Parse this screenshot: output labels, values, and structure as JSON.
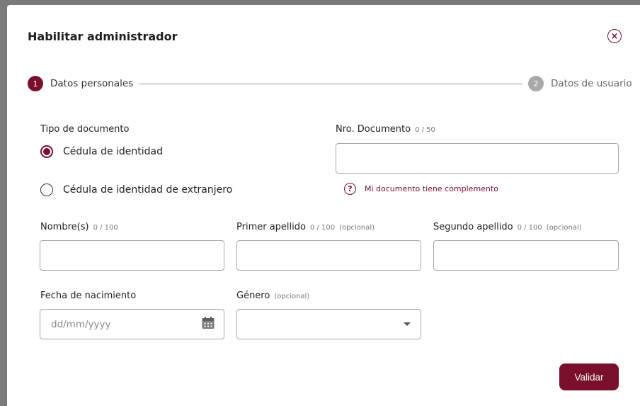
{
  "dialog": {
    "title": "Habilitar administrador",
    "close_icon": "close-icon",
    "validate_label": "Validar"
  },
  "stepper": {
    "steps": [
      {
        "number": "1",
        "label": "Datos personales",
        "state": "active"
      },
      {
        "number": "2",
        "label": "Datos de usuario",
        "state": "inactive"
      }
    ]
  },
  "form": {
    "tipo_documento": {
      "label": "Tipo de documento",
      "options": [
        {
          "label": "Cédula de identidad",
          "selected": true
        },
        {
          "label": "Cédula de identidad de extranjero",
          "selected": false
        }
      ]
    },
    "nro_documento": {
      "label": "Nro. Documento",
      "counter": "0 / 50",
      "value": ""
    },
    "complemento_link": "Mi documento tiene complemento",
    "nombres": {
      "label": "Nombre(s)",
      "counter": "0 / 100",
      "value": ""
    },
    "primer_apellido": {
      "label": "Primer apellido",
      "counter": "0 / 100",
      "optional": "(opcional)",
      "value": ""
    },
    "segundo_apellido": {
      "label": "Segundo apellido",
      "counter": "0 / 100",
      "optional": "(opcional)",
      "value": ""
    },
    "fecha_nacimiento": {
      "label": "Fecha de nacimiento",
      "placeholder": "dd/mm/yyyy",
      "icon": "calendar-icon"
    },
    "genero": {
      "label": "Género",
      "optional": "(opcional)",
      "value": ""
    }
  },
  "colors": {
    "accent": "#7a0f2c",
    "inactive_step": "#a9a9a9",
    "input_border": "#a8a8a8"
  }
}
